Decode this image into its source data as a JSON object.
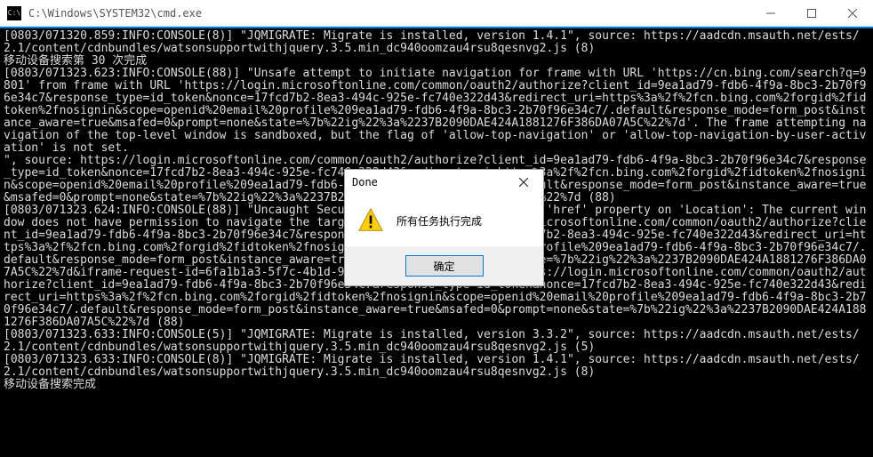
{
  "window": {
    "title": "C:\\Windows\\SYSTEM32\\cmd.exe",
    "icon_glyph": "C:\\"
  },
  "titlebar_buttons": {
    "minimize": "minimize-button",
    "maximize": "maximize-button",
    "close": "close-button"
  },
  "console_lines": [
    "[0803/071320.859:INFO:CONSOLE(8)] \"JQMIGRATE: Migrate is installed, version 1.4.1\", source: https://aadcdn.msauth.net/ests/2.1/content/cdnbundles/watsonsupportwithjquery.3.5.min_dc940oomzau4rsu8qesnvg2.js (8)",
    "移动设备搜索第 30 次完成",
    "[0803/071323.623:INFO:CONSOLE(88)] \"Unsafe attempt to initiate navigation for frame with URL 'https://cn.bing.com/search?q=9801' from frame with URL 'https://login.microsoftonline.com/common/oauth2/authorize?client_id=9ea1ad79-fdb6-4f9a-8bc3-2b70f96e34c7&response_type=id_token&nonce=17fcd7b2-8ea3-494c-925e-fc740e322d43&redirect_uri=https%3a%2f%2fcn.bing.com%2forgid%2fidtoken%2fnosignin&scope=openid%20email%20profile%209ea1ad79-fdb6-4f9a-8bc3-2b70f96e34c7/.default&response_mode=form_post&instance_aware=true&msafed=0&prompt=none&state=%7b%22ig%22%3a%2237B2090DAE424A1881276F386DA07A5C%22%7d'. The frame attempting navigation of the top-level window is sandboxed, but the flag of 'allow-top-navigation' or 'allow-top-navigation-by-user-activation' is not set.",
    "\", source: https://login.microsoftonline.com/common/oauth2/authorize?client_id=9ea1ad79-fdb6-4f9a-8bc3-2b70f96e34c7&response_type=id_token&nonce=17fcd7b2-8ea3-494c-925e-fc740e322d43&redirect_uri=https%3a%2f%2fcn.bing.com%2forgid%2fidtoken%2fnosignin&scope=openid%20email%20profile%209ea1ad79-fdb6-4f9a-8bc3-2b70f96e34c7/.default&response_mode=form_post&instance_aware=true&msafed=0&prompt=none&state=%7b%22ig%22%3a%2237B2090DAE424A1881276F386DA07A5C%22%7d (88)",
    "[0803/071323.624:INFO:CONSOLE(88)] \"Uncaught SecurityError: Failed to set the 'href' property on 'Location': The current window does not have permission to navigate the target frame to 'https://login.microsoftonline.com/common/oauth2/authorize?client_id=9ea1ad79-fdb6-4f9a-8bc3-2b70f96e34c7&response_type=id_token&nonce=17fcd7b2-8ea3-494c-925e-fc740e322d43&redirect_uri=https%3a%2f%2fcn.bing.com%2forgid%2fidtoken%2fnosignin&scope=openid%20email%20profile%209ea1ad79-fdb6-4f9a-8bc3-2b70f96e34c7/.default&response_mode=form_post&instance_aware=true&msafed=0&prompt=none&state=%7b%22ig%22%3a%2237B2090DAE424A1881276F386DA07A5C%22%7d&iframe-request-id=6fa1b1a3-5f7c-4b1d-92a0ec394600'.\", source: https://login.microsoftonline.com/common/oauth2/authorize?client_id=9ea1ad79-fdb6-4f9a-8bc3-2b70f96e34c7&response_type=id_token&nonce=17fcd7b2-8ea3-494c-925e-fc740e322d43&redirect_uri=https%3a%2f%2fcn.bing.com%2forgid%2fidtoken%2fnosignin&scope=openid%20email%20profile%209ea1ad79-fdb6-4f9a-8bc3-2b70f96e34c7/.default&response_mode=form_post&instance_aware=true&msafed=0&prompt=none&state=%7b%22ig%22%3a%2237B2090DAE424A1881276F386DA07A5C%22%7d (88)",
    "[0803/071323.633:INFO:CONSOLE(5)] \"JQMIGRATE: Migrate is installed, version 3.3.2\", source: https://aadcdn.msauth.net/ests/2.1/content/cdnbundles/watsonsupportwithjquery.3.5.min_dc940oomzau4rsu8qesnvg2.js (5)",
    "[0803/071323.633:INFO:CONSOLE(8)] \"JQMIGRATE: Migrate is installed, version 1.4.1\", source: https://aadcdn.msauth.net/ests/2.1/content/cdnbundles/watsonsupportwithjquery.3.5.min_dc940oomzau4rsu8qesnvg2.js (8)",
    "移动设备搜索完成"
  ],
  "dialog": {
    "title": "Done",
    "icon": "warning-icon",
    "message": "所有任务执行完成",
    "ok_label": "确定"
  }
}
